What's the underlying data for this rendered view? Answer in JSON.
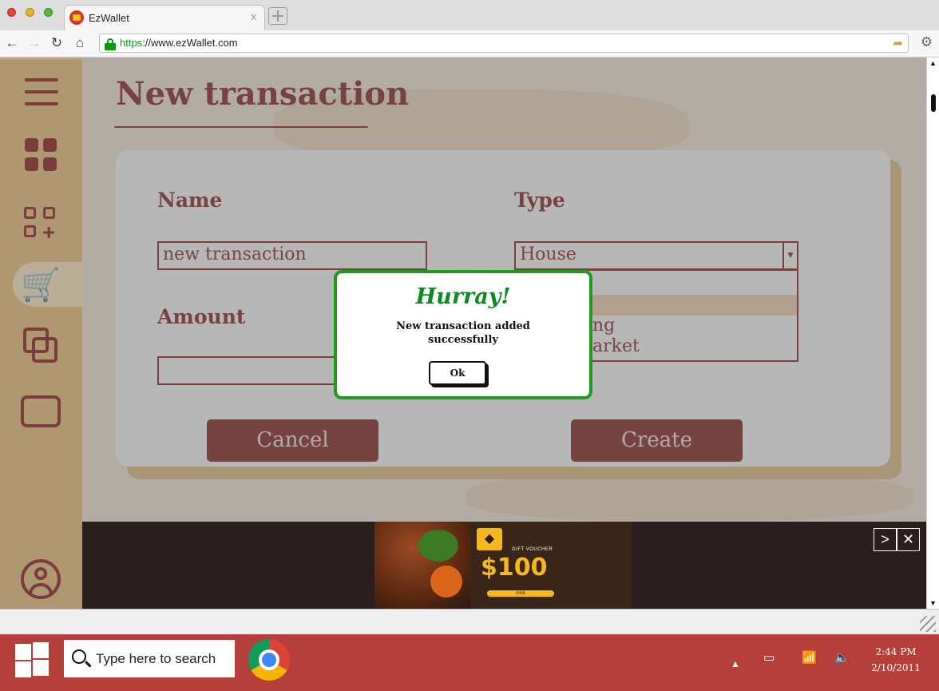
{
  "browser": {
    "tab_title": "EzWallet",
    "tab_close": "x",
    "url_scheme": "https",
    "url_rest": "://www.ezWallet.com"
  },
  "page": {
    "title": "New transaction",
    "form": {
      "name_label": "Name",
      "name_value": "new transaction",
      "type_label": "Type",
      "type_value": "House",
      "amount_label": "Amount",
      "amount_value": "",
      "dropdown_visible_fragments": [
        "ng",
        "arket"
      ],
      "cancel_label": "Cancel",
      "create_label": "Create"
    }
  },
  "modal": {
    "title": "Hurray!",
    "message_line1": "New transaction added",
    "message_line2": "successfully",
    "ok_label": "Ok"
  },
  "ad": {
    "voucher_label": "GIFT VOUCHER",
    "price": "$100",
    "click_label": "click"
  },
  "taskbar": {
    "search_placeholder": "Type here to search",
    "time": "2:44 PM",
    "date": "2/10/2011"
  },
  "colors": {
    "brand": "#8b2a2a",
    "sidebar": "#dbb57d",
    "success": "#1f9a1f",
    "taskbar": "#b5403b"
  }
}
